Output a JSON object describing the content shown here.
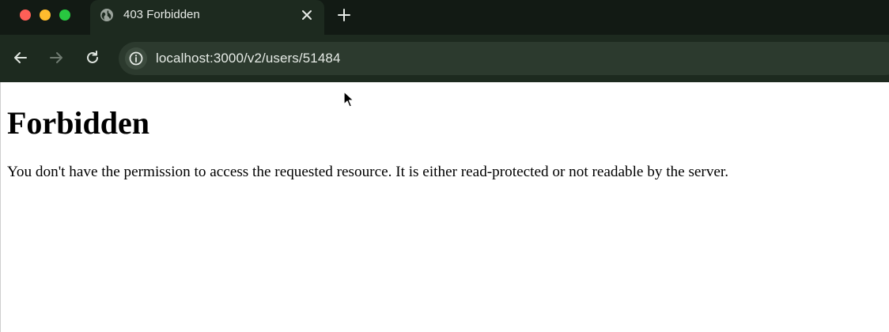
{
  "browser": {
    "tab": {
      "title": "403 Forbidden",
      "icon": "globe-icon"
    },
    "toolbar": {
      "back_icon": "arrow-left-icon",
      "forward_icon": "arrow-right-icon",
      "reload_icon": "reload-icon",
      "url": "localhost:3000/v2/users/51484",
      "security_icon": "info-icon"
    },
    "colors": {
      "tabstrip": "#121a14",
      "toolbar": "#1d2a1f",
      "omnibox": "#2c3a2e",
      "close": "#fe5f57",
      "minimize": "#febc2e",
      "maximize": "#28c840"
    }
  },
  "page": {
    "title": "Forbidden",
    "message": "You don't have the permission to access the requested resource. It is either read-protected or not readable by the server."
  }
}
